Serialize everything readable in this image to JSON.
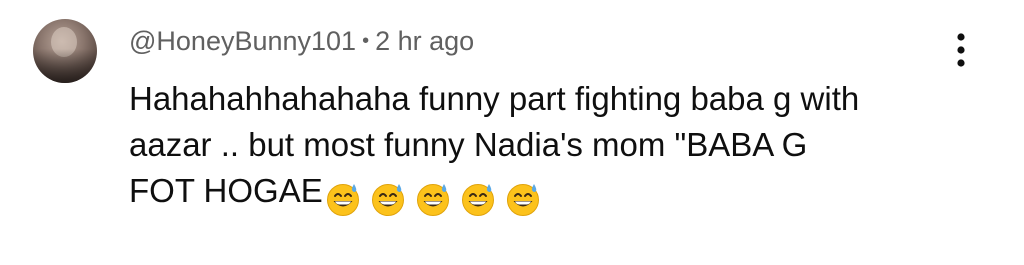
{
  "comment": {
    "username": "@HoneyBunny101",
    "separator": "•",
    "time_ago": "2 hr ago",
    "text_lines": [
      "Hahahahhahahaha funny part fighting baba g with",
      "aazar .. but most funny Nadia's mom \"BABA G",
      "FOT HOGAE"
    ],
    "emojis": [
      "grinning-face-with-sweat",
      "grinning-face-with-sweat",
      "grinning-face-with-sweat",
      "grinning-face-with-sweat",
      "grinning-face-with-sweat"
    ],
    "menu_icon": "more-vert-icon",
    "colors": {
      "meta_text": "#606060",
      "body_text": "#0f0f0f",
      "emoji_face": "#fcc21b",
      "emoji_sweat": "#5aa9e6"
    }
  }
}
